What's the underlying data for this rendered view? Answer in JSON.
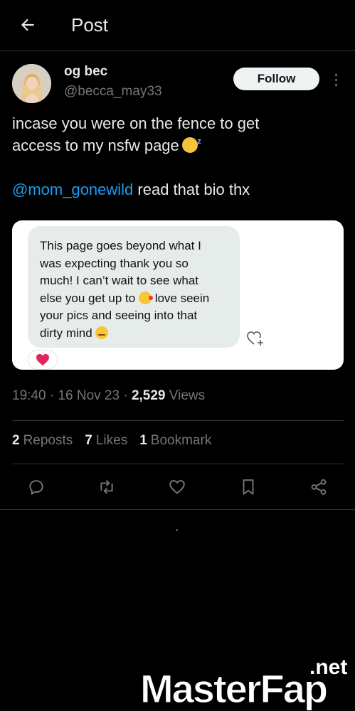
{
  "header": {
    "title": "Post"
  },
  "author": {
    "display_name": "og bec",
    "handle": "@becca_may33",
    "follow_label": "Follow"
  },
  "tweet": {
    "line1": "incase you were on the fence to get",
    "line2": "access to my nsfw page",
    "mention": "@mom_gonewild",
    "line3_rest": " read that bio thx"
  },
  "media": {
    "message_lines": [
      "This page goes beyond what I",
      "was expecting thank you so",
      "much! I can’t wait to see what",
      "else you get up to",
      "love seein",
      "your pics and seeing into that",
      "dirty mind"
    ],
    "reaction": "❤️"
  },
  "meta": {
    "time": "19:40",
    "sep1": " · ",
    "date": "16 Nov 23",
    "sep2": " · ",
    "views_count": "2,529",
    "views_label": " Views"
  },
  "stats": [
    {
      "count": "2",
      "label": "Reposts"
    },
    {
      "count": "7",
      "label": "Likes"
    },
    {
      "count": "1",
      "label": "Bookmark"
    }
  ],
  "actions": [
    "reply-icon",
    "repost-icon",
    "like-icon",
    "bookmark-icon",
    "share-icon"
  ],
  "watermark": {
    "main": "MasterFap",
    "suffix": ".net"
  },
  "colors": {
    "background": "#000000",
    "text": "#e7e9ea",
    "muted": "#71767b",
    "link": "#1d9bf0",
    "follow_bg": "#eff3f4"
  }
}
